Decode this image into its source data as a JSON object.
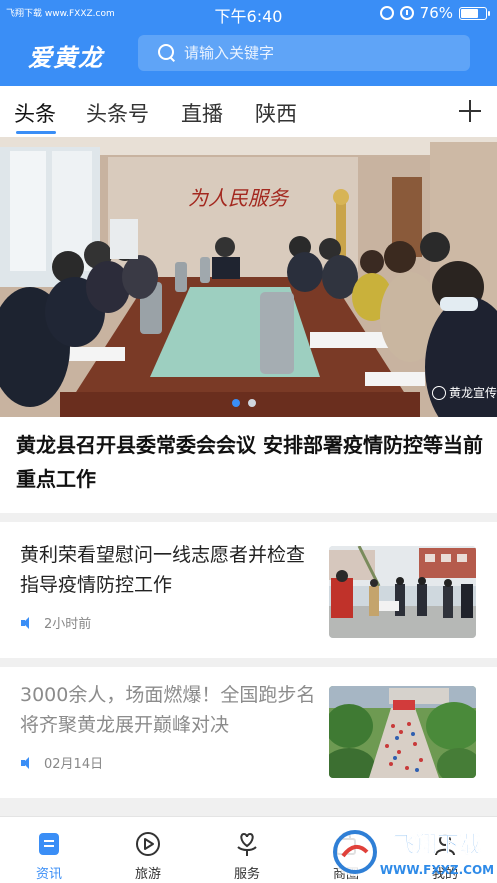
{
  "status_bar": {
    "watermark_left": "飞翔下载 www.FXXZ.com",
    "time": "下午6:40",
    "battery": "76%",
    "battery_level": 0.76
  },
  "header": {
    "logo": "爱黄龙",
    "search_placeholder": "请输入关键字",
    "accent_color": "#3a8ef6"
  },
  "tabs": [
    {
      "label": "头条",
      "active": true
    },
    {
      "label": "头条号",
      "active": false
    },
    {
      "label": "直播",
      "active": false
    },
    {
      "label": "陕西",
      "active": false
    }
  ],
  "banner": {
    "banner_text": "为人民服务",
    "watermark": "黄龙宣传",
    "title": "黄龙县召开县委常委会会议 安排部署疫情防控等当前重点工作",
    "page_count": 2,
    "current_page": 1
  },
  "news": [
    {
      "title": "黄利荣看望慰问一线志愿者并检查指导疫情防控工作",
      "time": "2小时前",
      "read": false
    },
    {
      "title": "3000余人，场面燃爆！全国跑步名将齐聚黄龙展开巅峰对决",
      "time": "02月14日",
      "read": true
    }
  ],
  "bottom_nav": [
    {
      "label": "资讯",
      "icon": "news-icon",
      "active": true
    },
    {
      "label": "旅游",
      "icon": "play-icon",
      "active": false
    },
    {
      "label": "服务",
      "icon": "heart-hand-icon",
      "active": false
    },
    {
      "label": "商圈",
      "icon": "shop-icon",
      "active": false
    },
    {
      "label": "我的",
      "icon": "user-icon",
      "active": false
    }
  ],
  "corner_watermark": {
    "brand": "飞翔下载",
    "url": "WWW.FXXZ.COM"
  }
}
